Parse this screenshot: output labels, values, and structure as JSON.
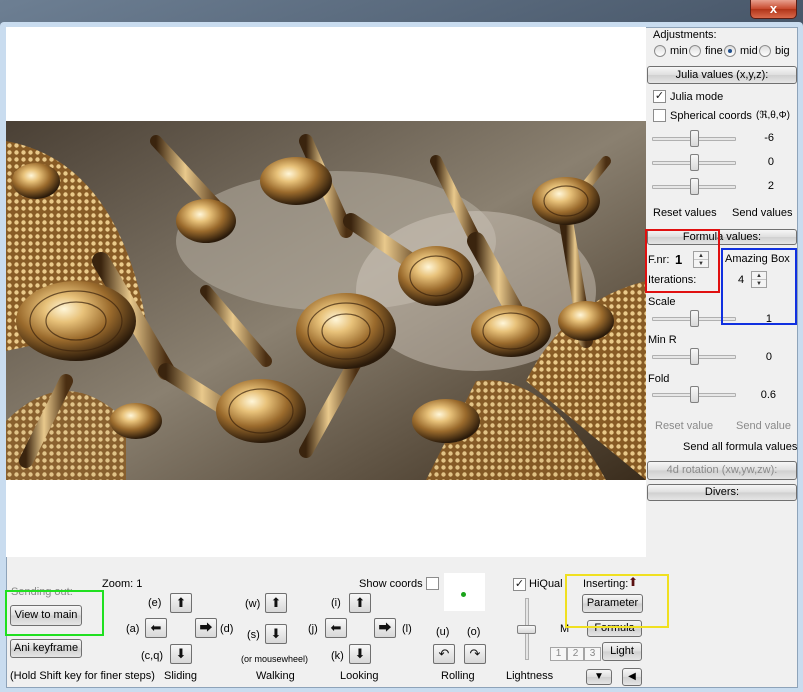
{
  "window": {
    "close_glyph": "x"
  },
  "adjustments": {
    "title": "Adjustments:",
    "options": [
      "min",
      "fine",
      "mid",
      "big"
    ],
    "selected": "mid"
  },
  "julia": {
    "button": "Julia values (x,y,z):",
    "mode_label": "Julia mode",
    "mode_checked": true,
    "spherical_label": "Spherical coords",
    "spherical_symbols": "(ℜ,θ,Φ)",
    "spherical_checked": false,
    "values": [
      "-6",
      "0",
      "2"
    ],
    "levels": [
      0.5,
      0.5,
      0.5
    ],
    "reset": "Reset values",
    "send": "Send values"
  },
  "formula": {
    "button": "Formula values:",
    "fnr_label": "F.nr:",
    "fnr_value": "1",
    "iterations_label": "Iterations:",
    "name": "Amazing Box",
    "iterations_value": "4",
    "params": [
      {
        "label": "Scale",
        "value": "1"
      },
      {
        "label": "Min R",
        "value": "0"
      },
      {
        "label": "Fold",
        "value": "0.6"
      }
    ],
    "levels": [
      0.5,
      0.5,
      0.5
    ],
    "reset_value": "Reset value",
    "send_value": "Send value",
    "send_all": "Send all formula values",
    "rotation": "4d rotation (xw,yw,zw):",
    "divers": "Divers:"
  },
  "bottom": {
    "sending_out": "Sending out:",
    "view_to_main": "View to main",
    "ani_keyframe": "Ani keyframe",
    "hold_shift": "(Hold Shift key for finer steps)",
    "zoom": "Zoom: 1",
    "show_coords": "Show coords",
    "hiqual": "HiQual",
    "hiqual_checked": true,
    "inserting": "Inserting:",
    "parameter": "Parameter",
    "formula": "Formula",
    "light": "Light",
    "m_label": "M",
    "num_buttons": [
      "1",
      "2",
      "3"
    ],
    "sliding": {
      "caption": "Sliding",
      "up": "(e)",
      "left": "(a)",
      "right": "(d)",
      "down": "(c,q)"
    },
    "walking": {
      "caption": "Walking",
      "up": "(w)",
      "down": "(s)",
      "note": "(or mousewheel)"
    },
    "looking": {
      "caption": "Looking",
      "up": "(i)",
      "left": "(j)",
      "right": "(l)",
      "down": "(k)"
    },
    "rolling": {
      "caption": "Rolling",
      "left": "(u)",
      "right": "(o)"
    },
    "lightness": {
      "caption": "Lightness",
      "level": 0.5
    }
  },
  "icons": {
    "arrow_up": "⬆",
    "arrow_down": "⬇",
    "arrow_left": "⬅",
    "arrow_right": "⮕",
    "roll_left": "↶",
    "roll_right": "↷",
    "tri_down": "▼",
    "tri_left": "◀",
    "insert_arrow": "⬆"
  },
  "colors": {
    "highlight_red": "#e01010",
    "highlight_blue": "#1030e0",
    "highlight_green": "#20e020",
    "highlight_yellow": "#f0e020"
  }
}
